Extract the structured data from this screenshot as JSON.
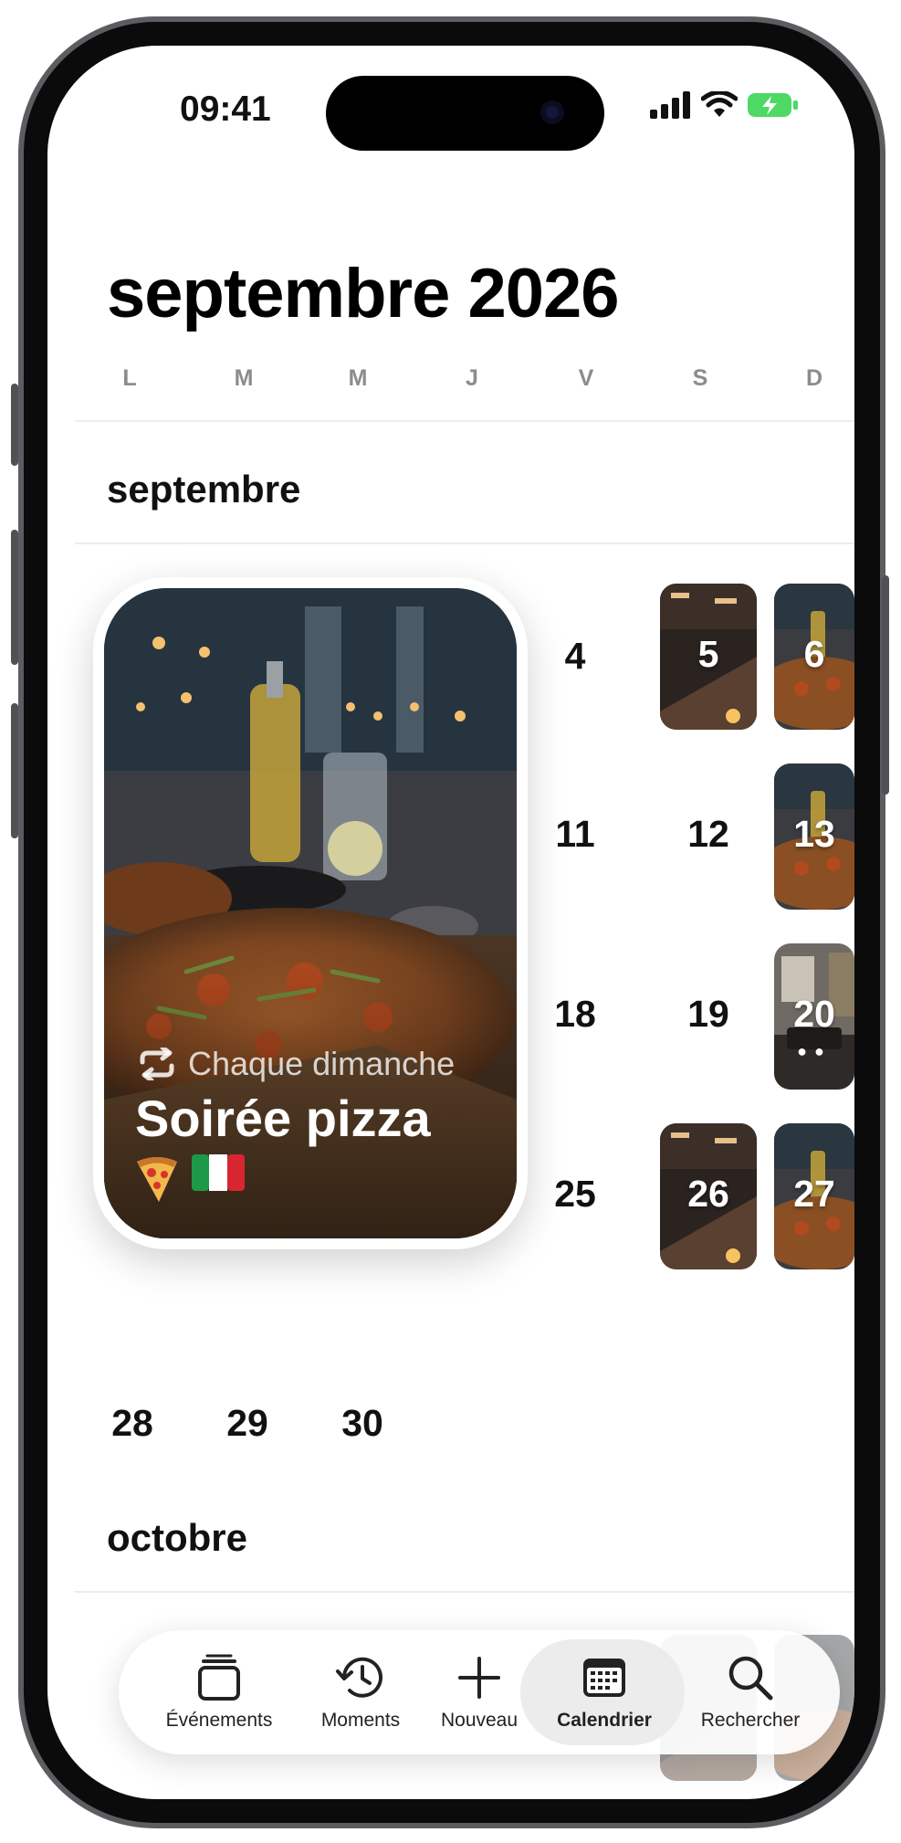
{
  "status_bar": {
    "time": "09:41",
    "icons": [
      "signal-icon",
      "wifi-icon",
      "battery-charging-icon"
    ]
  },
  "header": {
    "title": "septembre 2026"
  },
  "weekdays": [
    "L",
    "M",
    "M",
    "J",
    "V",
    "S",
    "D"
  ],
  "months": {
    "first": "septembre",
    "second": "octobre"
  },
  "featured_event": {
    "repeat_label": "Chaque dimanche",
    "title": "Soirée pizza",
    "emojis": [
      "pizza-emoji",
      "italy-flag-emoji"
    ]
  },
  "calendar_days": {
    "row1": [
      "4",
      "5",
      "6"
    ],
    "row2": [
      "11",
      "12",
      "13"
    ],
    "row3": [
      "18",
      "19",
      "20"
    ],
    "row4": [
      "25",
      "26",
      "27"
    ],
    "row5": [
      "28",
      "29",
      "30"
    ]
  },
  "tabbar": {
    "items": [
      {
        "label": "Événements",
        "icon": "stack-icon"
      },
      {
        "label": "Moments",
        "icon": "history-icon"
      },
      {
        "label": "Nouveau",
        "icon": "plus-icon"
      },
      {
        "label": "Calendrier",
        "icon": "calendar-icon",
        "active": true
      },
      {
        "label": "Rechercher",
        "icon": "search-icon"
      }
    ]
  },
  "colors": {
    "accent": "#111111",
    "background": "#ffffff",
    "weekday_gray": "#8c8c8c",
    "active_tab_bg": "#ececec"
  }
}
